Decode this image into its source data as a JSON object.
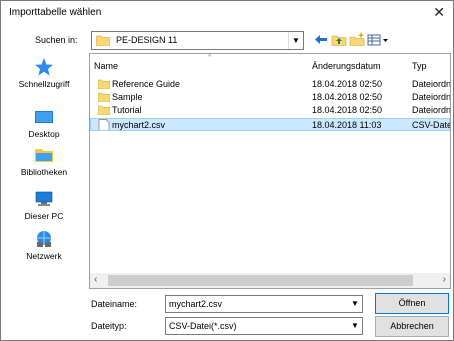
{
  "dialog": {
    "title": "Importtabelle wählen",
    "close_glyph": "✕"
  },
  "lookin": {
    "label": "Suchen in:",
    "value": "PE-DESIGN 11"
  },
  "toolbar": {
    "icons": [
      "back-icon",
      "up-folder-icon",
      "new-folder-icon",
      "view-menu-icon"
    ]
  },
  "places": [
    {
      "label": "Schnellzugriff",
      "icon": "star-icon"
    },
    {
      "label": "Desktop",
      "icon": "desktop-icon"
    },
    {
      "label": "Bibliotheken",
      "icon": "library-icon"
    },
    {
      "label": "Dieser PC",
      "icon": "computer-icon"
    },
    {
      "label": "Netzwerk",
      "icon": "network-icon"
    }
  ],
  "columns": {
    "name": "Name",
    "date": "Änderungsdatum",
    "type": "Typ"
  },
  "files": [
    {
      "name": "Reference Guide",
      "date": "18.04.2018 02:50",
      "type": "Dateiordn",
      "kind": "folder"
    },
    {
      "name": "Sample",
      "date": "18.04.2018 02:50",
      "type": "Dateiordn",
      "kind": "folder"
    },
    {
      "name": "Tutorial",
      "date": "18.04.2018 02:50",
      "type": "Dateiordn",
      "kind": "folder"
    },
    {
      "name": "mychart2.csv",
      "date": "18.04.2018 11:03",
      "type": "CSV-Datei",
      "kind": "file",
      "selected": true
    }
  ],
  "filename": {
    "label": "Dateiname:",
    "value": "mychart2.csv"
  },
  "filetype": {
    "label": "Dateityp:",
    "value": "CSV-Datei(*.csv)"
  },
  "buttons": {
    "open": "Öffnen",
    "cancel": "Abbrechen"
  },
  "colors": {
    "folder": "#f8d775",
    "selection": "#cce8ff",
    "accent": "#0078d7"
  }
}
